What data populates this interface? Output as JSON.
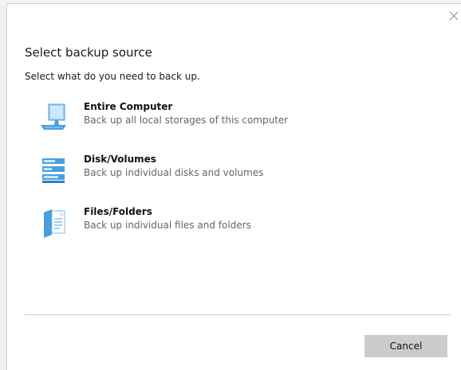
{
  "dialog": {
    "title": "Select backup source",
    "subtitle": "Select what do you need to back up.",
    "close_icon": "close-icon"
  },
  "options": [
    {
      "title": "Entire Computer",
      "description": "Back up all local storages of this computer",
      "icon": "computer-icon"
    },
    {
      "title": "Disk/Volumes",
      "description": "Back up individual disks and volumes",
      "icon": "disk-volumes-icon"
    },
    {
      "title": "Files/Folders",
      "description": "Back up individual files and folders",
      "icon": "files-folders-icon"
    }
  ],
  "footer": {
    "cancel_label": "Cancel"
  },
  "colors": {
    "accent": "#4a9ede",
    "cancel_button": "#cccccc",
    "description_text": "#666666"
  }
}
